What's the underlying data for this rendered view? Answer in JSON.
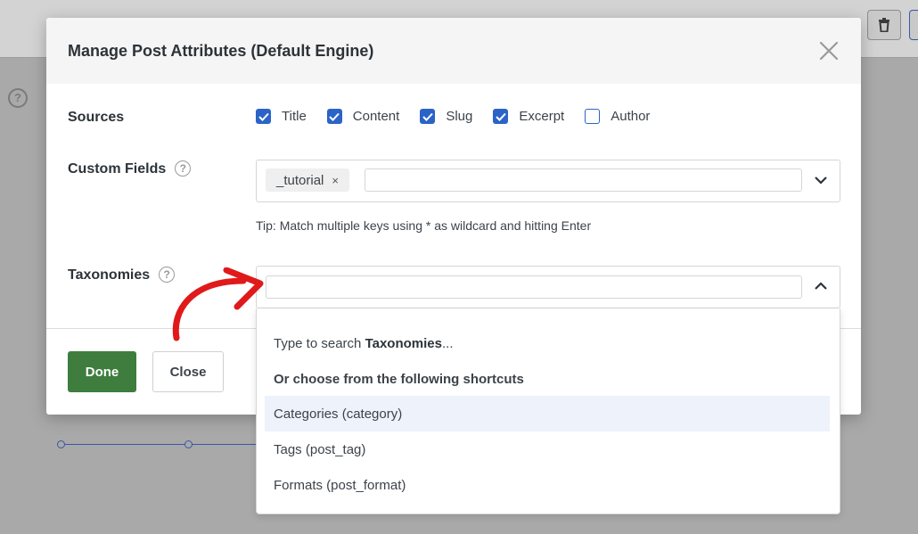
{
  "modal": {
    "title": "Manage Post Attributes (Default Engine)",
    "close_icon": "close-icon"
  },
  "sources": {
    "label": "Sources",
    "options": [
      {
        "label": "Title",
        "checked": true
      },
      {
        "label": "Content",
        "checked": true
      },
      {
        "label": "Slug",
        "checked": true
      },
      {
        "label": "Excerpt",
        "checked": true
      },
      {
        "label": "Author",
        "checked": false
      }
    ]
  },
  "custom_fields": {
    "label": "Custom Fields",
    "help_icon": "help-icon",
    "selected_tag": "_tutorial",
    "tag_remove": "×",
    "input_value": "",
    "tip": "Tip: Match multiple keys using * as wildcard and hitting Enter"
  },
  "taxonomies": {
    "label": "Taxonomies",
    "help_icon": "help-icon",
    "input_value": "",
    "dropdown": {
      "hint_prefix": "Type to search ",
      "hint_bold": "Taxonomies",
      "hint_suffix": "...",
      "shortcuts_heading": "Or choose from the following shortcuts",
      "options": [
        {
          "label": "Categories (category)",
          "highlighted": true
        },
        {
          "label": "Tags (post_tag)",
          "highlighted": false
        },
        {
          "label": "Formats (post_format)",
          "highlighted": false
        }
      ]
    }
  },
  "footer": {
    "done_label": "Done",
    "close_label": "Close"
  },
  "colors": {
    "accent_blue": "#2b63c8",
    "done_green": "#3e7d3e",
    "annotation_red": "#e0191b"
  }
}
